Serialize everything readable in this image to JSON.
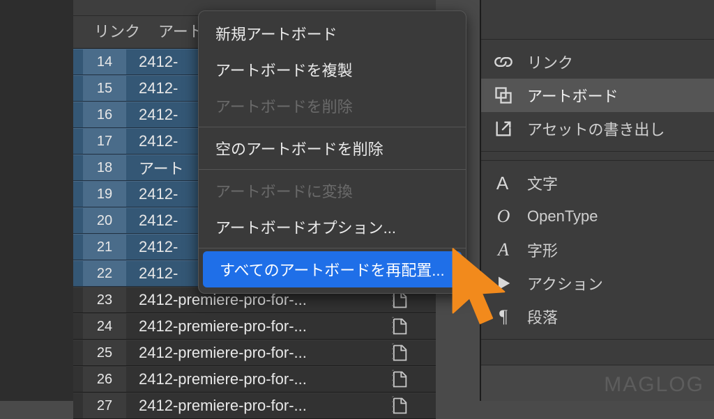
{
  "tabs": {
    "link": "リンク",
    "artboard": "アート"
  },
  "rows": [
    {
      "num": "14",
      "name": "2412-",
      "selected": true
    },
    {
      "num": "15",
      "name": "2412-",
      "selected": true
    },
    {
      "num": "16",
      "name": "2412-",
      "selected": true
    },
    {
      "num": "17",
      "name": "2412-",
      "selected": true
    },
    {
      "num": "18",
      "name": "アート",
      "selected": true
    },
    {
      "num": "19",
      "name": "2412-",
      "selected": true
    },
    {
      "num": "20",
      "name": "2412-",
      "selected": true
    },
    {
      "num": "21",
      "name": "2412-",
      "selected": true
    },
    {
      "num": "22",
      "name": "2412-",
      "selected": true
    },
    {
      "num": "23",
      "name": "2412-premiere-pro-for-...",
      "selected": false
    },
    {
      "num": "24",
      "name": "2412-premiere-pro-for-...",
      "selected": false
    },
    {
      "num": "25",
      "name": "2412-premiere-pro-for-...",
      "selected": false
    },
    {
      "num": "26",
      "name": "2412-premiere-pro-for-...",
      "selected": false
    },
    {
      "num": "27",
      "name": "2412-premiere-pro-for-...",
      "selected": false
    }
  ],
  "menu": {
    "new": "新規アートボード",
    "duplicate": "アートボードを複製",
    "delete": "アートボードを削除",
    "deleteEmpty": "空のアートボードを削除",
    "convert": "アートボードに変換",
    "options": "アートボードオプション...",
    "rearrange": "すべてのアートボードを再配置..."
  },
  "dock": {
    "group1": {
      "link": "リンク",
      "artboard": "アートボード",
      "assetExport": "アセットの書き出し"
    },
    "group2": {
      "char": "文字",
      "opentype": "OpenType",
      "glyphs": "字形",
      "actions": "アクション",
      "paragraph": "段落"
    }
  },
  "watermark": "MAGLOG"
}
